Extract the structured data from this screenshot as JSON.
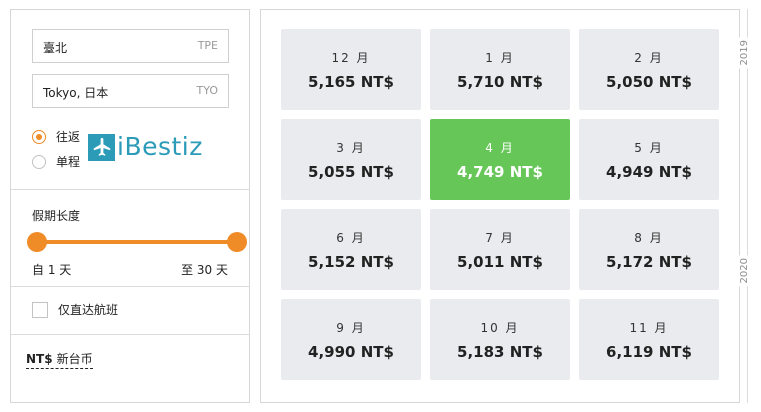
{
  "filters": {
    "origin": {
      "city": "臺北",
      "code": "TPE"
    },
    "destination": {
      "city": "Tokyo, 日本",
      "code": "TYO"
    },
    "trip_type": {
      "options": [
        "往返",
        "单程"
      ],
      "selected": "往返"
    },
    "brand": {
      "name": "iBestiz",
      "color": "#2b9bb8"
    },
    "duration": {
      "title": "假期长度",
      "min_label": "自 1 天",
      "max_label": "至 30 天",
      "min_days": 1,
      "max_days": 30
    },
    "direct_only": {
      "label": "仅直达航班",
      "checked": false
    },
    "currency": {
      "code": "NT$",
      "name": "新台币"
    }
  },
  "calendar": {
    "years": [
      "2019",
      "2020"
    ],
    "cells": [
      {
        "month": "12 月",
        "price": "5,165 NT$"
      },
      {
        "month": "1 月",
        "price": "5,710 NT$"
      },
      {
        "month": "2 月",
        "price": "5,050 NT$"
      },
      {
        "month": "3 月",
        "price": "5,055 NT$"
      },
      {
        "month": "4 月",
        "price": "4,749 NT$",
        "selected": true
      },
      {
        "month": "5 月",
        "price": "4,949 NT$"
      },
      {
        "month": "6 月",
        "price": "5,152 NT$"
      },
      {
        "month": "7 月",
        "price": "5,011 NT$"
      },
      {
        "month": "8 月",
        "price": "5,172 NT$"
      },
      {
        "month": "9 月",
        "price": "4,990 NT$"
      },
      {
        "month": "10 月",
        "price": "5,183 NT$"
      },
      {
        "month": "11 月",
        "price": "6,119 NT$"
      }
    ]
  },
  "colors": {
    "accent": "#f08c28",
    "selected": "#66c658",
    "cell": "#e9ebee",
    "brand": "#2b9bb8"
  }
}
